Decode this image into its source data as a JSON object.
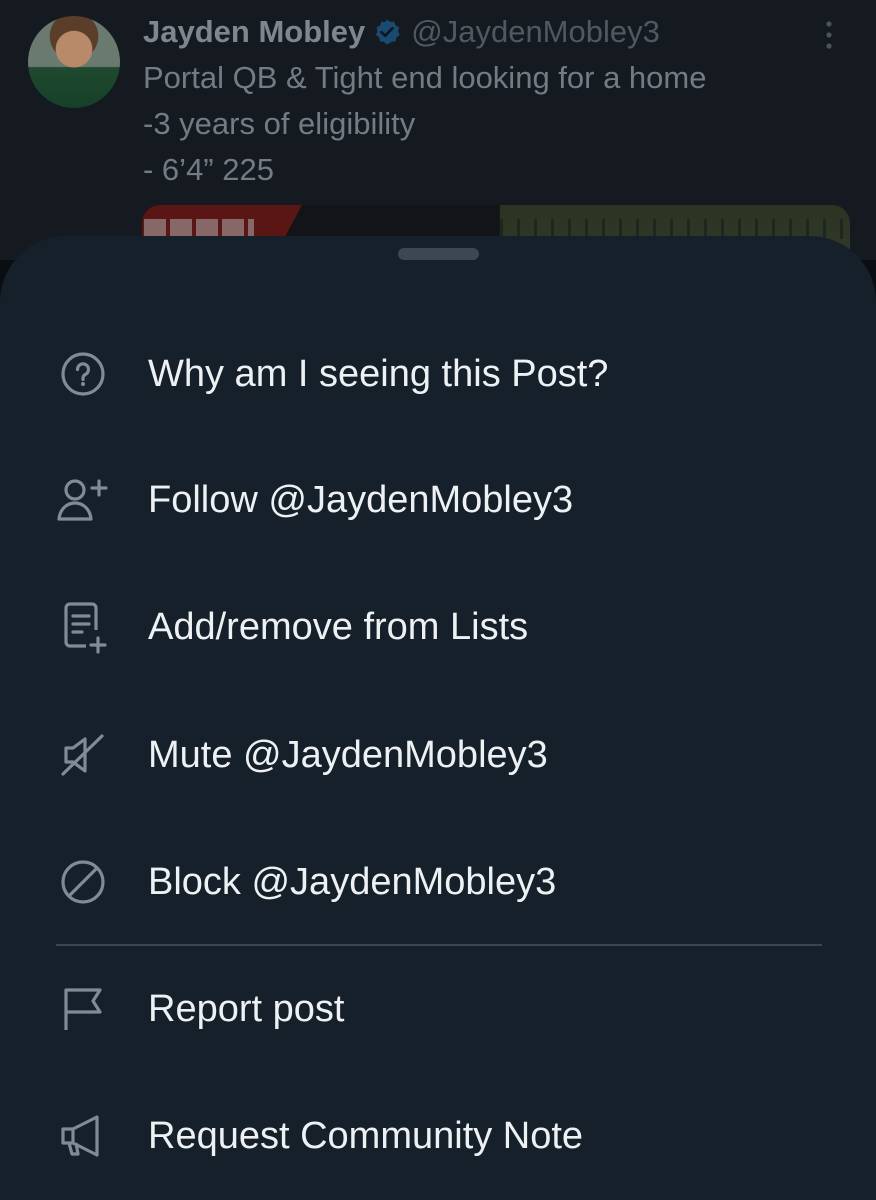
{
  "tweet": {
    "author_name": "Jayden Mobley",
    "author_handle": "@JaydenMobley3",
    "text_lines": [
      "Portal QB & Tight end looking for a home",
      "-3 years of eligibility",
      "- 6’4” 225"
    ],
    "icons": {
      "verified": "verified-badge-icon",
      "more": "more-options-icon"
    }
  },
  "sheet": {
    "items": [
      {
        "label": "Why am I seeing this Post?",
        "icon": "question-circle-icon"
      },
      {
        "label": "Follow @JaydenMobley3",
        "icon": "follow-user-icon"
      },
      {
        "label": "Add/remove from Lists",
        "icon": "list-add-icon"
      },
      {
        "label": "Mute @JaydenMobley3",
        "icon": "mute-icon"
      },
      {
        "label": "Block @JaydenMobley3",
        "icon": "block-icon"
      },
      {
        "label": "Report post",
        "icon": "flag-icon"
      },
      {
        "label": "Request Community Note",
        "icon": "megaphone-icon"
      }
    ]
  },
  "colors": {
    "sheet_background": "#16202a",
    "text_primary": "#eef1f4",
    "icon_color": "#7f8b96",
    "verified_blue": "#1d9bf0"
  }
}
